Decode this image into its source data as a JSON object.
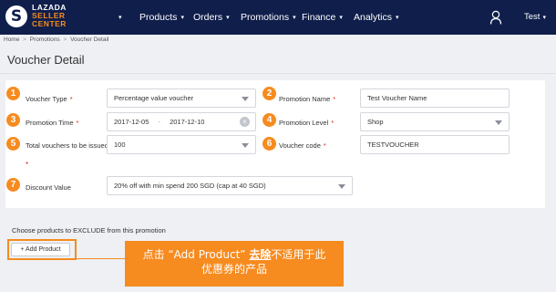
{
  "colors": {
    "nav_bg": "#0f1e4b",
    "accent": "#f68b1f",
    "required": "#e2231a",
    "page_bg": "#eef0f4"
  },
  "logo": {
    "line1": "LAZADA",
    "line2": "SELLER",
    "line3": "CENTER",
    "mark": "S"
  },
  "nav": {
    "items": [
      {
        "label": "Products"
      },
      {
        "label": "Orders"
      },
      {
        "label": "Promotions"
      },
      {
        "label": "Finance"
      },
      {
        "label": "Analytics"
      }
    ],
    "caret": "▾",
    "user_icon": "user-icon",
    "user_label": "Test"
  },
  "breadcrumb": {
    "home": "Home",
    "promotions": "Promotions",
    "current": "Voucher Detail",
    "separator": ">"
  },
  "page": {
    "title": "Voucher Detail"
  },
  "form": {
    "voucher_type": {
      "badge": "1",
      "label": "Voucher Type",
      "req": "*",
      "value": "Percentage value voucher"
    },
    "promotion_name": {
      "badge": "2",
      "label": "Promotion Name",
      "req": "*",
      "value": "Test Voucher Name"
    },
    "promotion_time": {
      "badge": "3",
      "label": "Promotion Time",
      "req": "*",
      "start": "2017-12-05",
      "dash": "-",
      "end": "2017-12-10",
      "clear": "×"
    },
    "promotion_level": {
      "badge": "4",
      "label": "Promotion Level",
      "req": "*",
      "value": "Shop"
    },
    "total_vouchers": {
      "badge": "5",
      "label": "Total vouchers to be issued",
      "req": "*",
      "value": "100"
    },
    "voucher_code": {
      "badge": "6",
      "label": "Voucher code",
      "req": "*",
      "value": "TESTVOUCHER"
    },
    "discount_value": {
      "badge": "7",
      "label": "Discount Value",
      "value": "20% off with min spend 200 SGD (cap at 40 SGD)"
    }
  },
  "exclude": {
    "text": "Choose products to EXCLUDE from this promotion",
    "button": "+ Add Product"
  },
  "callout": {
    "part1": "点击 “Add Product” ",
    "emphasis": "去除",
    "part2": "不适用于此",
    "line2": "优惠券的产品"
  }
}
